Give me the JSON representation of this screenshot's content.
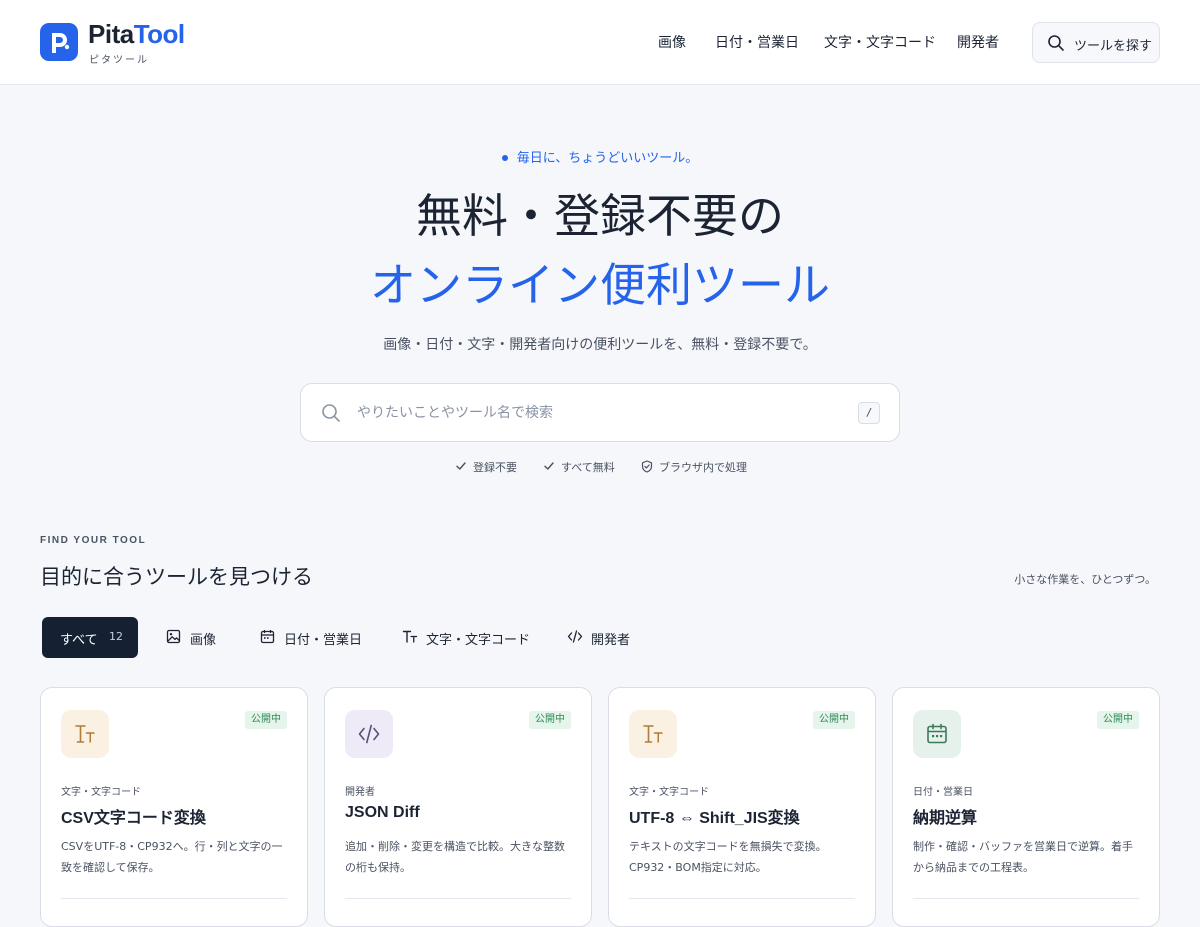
{
  "brand": {
    "name_part1": "Pita",
    "name_part2": "Tool",
    "sub": "ピタツール",
    "color": "#2563eb"
  },
  "nav": {
    "items": [
      "画像",
      "日付・営業日",
      "文字・文字コード",
      "開発者"
    ],
    "search_label": "ツールを探す"
  },
  "hero": {
    "tagline": "毎日に、ちょうどいいツール。",
    "title_line1": "無料・登録不要の",
    "title_line2": "オンライン便利ツール",
    "subtitle": "画像・日付・文字・開発者向けの便利ツールを、無料・登録不要で。",
    "search_placeholder": "やりたいことやツール名で検索",
    "search_shortcut": "/",
    "badges": [
      "登録不要",
      "すべて無料",
      "ブラウザ内で処理"
    ]
  },
  "section": {
    "eyebrow": "FIND YOUR TOOL",
    "title": "目的に合うツールを見つける",
    "side_text": "小さな作業を、ひとつずつ。"
  },
  "filters": {
    "all_label": "すべて",
    "all_count": "12",
    "items": [
      {
        "label": "画像",
        "icon": "image-icon"
      },
      {
        "label": "日付・営業日",
        "icon": "calendar-icon"
      },
      {
        "label": "文字・文字コード",
        "icon": "text-icon"
      },
      {
        "label": "開発者",
        "icon": "code-icon"
      }
    ]
  },
  "cards": [
    {
      "status": "公開中",
      "category": "文字・文字コード",
      "name": "CSV文字コード変換",
      "desc": "CSVをUTF-8・CP932へ。行・列と文字の一致を確認して保存。",
      "icon": "text-icon",
      "icon_bg": "#fbf1e3",
      "icon_color": "#b07a3a"
    },
    {
      "status": "公開中",
      "category": "開発者",
      "name": "JSON Diff",
      "desc": "追加・削除・変更を構造で比較。大きな整数の桁も保持。",
      "icon": "code-icon",
      "icon_bg": "#eeeaf8",
      "icon_color": "#5a4f7a"
    },
    {
      "status": "公開中",
      "category": "文字・文字コード",
      "name": "UTF-8 ⇔ Shift_JIS変換",
      "desc": "テキストの文字コードを無損失で変換。CP932・BOM指定に対応。",
      "icon": "text-icon",
      "icon_bg": "#fbf1e3",
      "icon_color": "#b07a3a"
    },
    {
      "status": "公開中",
      "category": "日付・営業日",
      "name": "納期逆算",
      "desc": "制作・確認・バッファを営業日で逆算。着手から納品までの工程表。",
      "icon": "calendar-icon",
      "icon_bg": "#e5f1ea",
      "icon_color": "#3f7a58"
    }
  ]
}
